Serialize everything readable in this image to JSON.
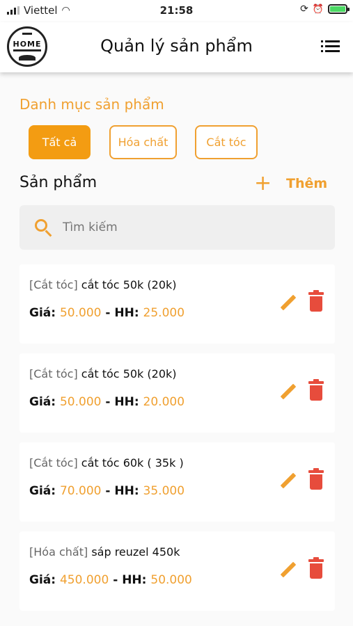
{
  "status_bar": {
    "carrier": "Viettel",
    "time": "21:58",
    "battery_level": 1.0
  },
  "header": {
    "logo_text": "HOME",
    "title": "Quản lý sản phẩm",
    "menu_icon": "list-icon"
  },
  "categories": {
    "title": "Danh mục sản phẩm",
    "items": [
      {
        "label": "Tất cả",
        "active": true
      },
      {
        "label": "Hóa chất",
        "active": false
      },
      {
        "label": "Cắt tóc",
        "active": false
      }
    ]
  },
  "products": {
    "title": "Sản phẩm",
    "add_label": "Thêm",
    "add_icon": "plus-icon",
    "search_placeholder": "Tìm kiếm",
    "price_label": "Giá:",
    "commission_label": "- HH:",
    "items": [
      {
        "category": "[Cắt tóc]",
        "name": "cắt tóc 50k (20k)",
        "price": "50.000",
        "commission": "25.000"
      },
      {
        "category": "[Cắt tóc]",
        "name": "cắt tóc 50k (20k)",
        "price": "50.000",
        "commission": "20.000"
      },
      {
        "category": "[Cắt tóc]",
        "name": "cắt tóc 60k ( 35k )",
        "price": "70.000",
        "commission": "35.000"
      },
      {
        "category": "[Hóa chất]",
        "name": "sáp reuzel 450k",
        "price": "450.000",
        "commission": "50.000"
      }
    ]
  },
  "colors": {
    "accent": "#f39c12",
    "delete": "#e74c3c"
  }
}
